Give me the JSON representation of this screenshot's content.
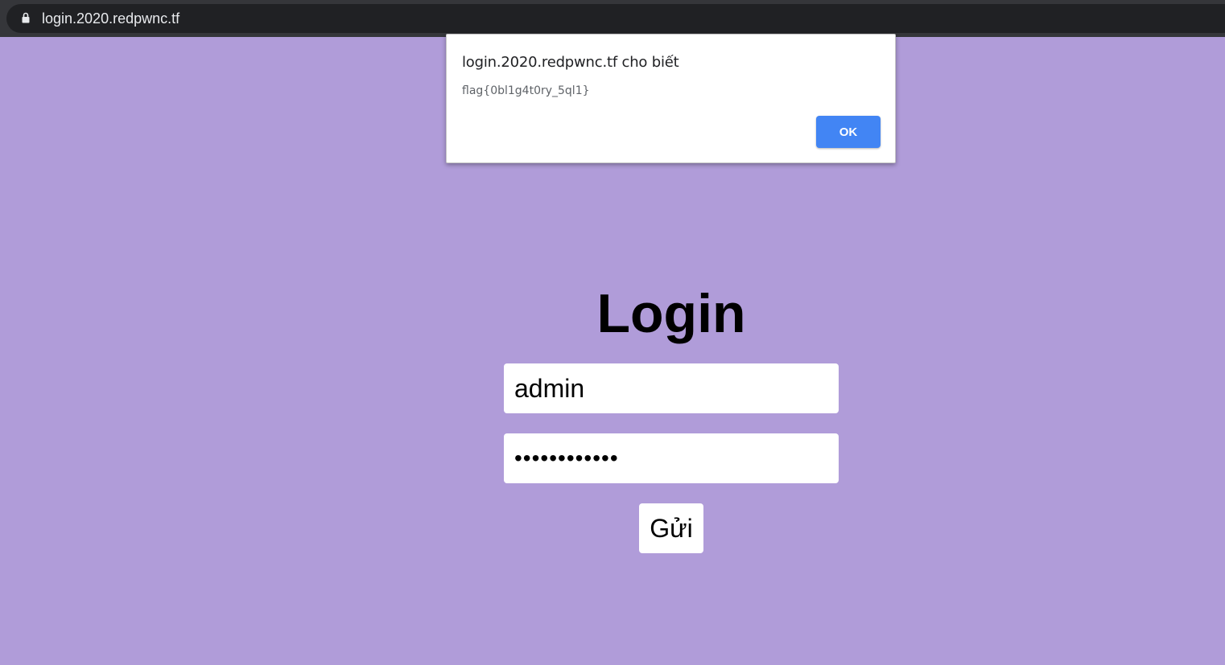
{
  "browser": {
    "url": "login.2020.redpwnc.tf",
    "lock_icon": "lock-icon"
  },
  "alert": {
    "title": "login.2020.redpwnc.tf cho biết",
    "message": "flag{0bl1g4t0ry_5ql1}",
    "ok_label": "OK",
    "ok_color": "#4285f4"
  },
  "page": {
    "background": "#b09cd9",
    "title": "Login",
    "username_value": "admin",
    "password_value": "••••••••••••",
    "submit_label": "Gửi"
  }
}
